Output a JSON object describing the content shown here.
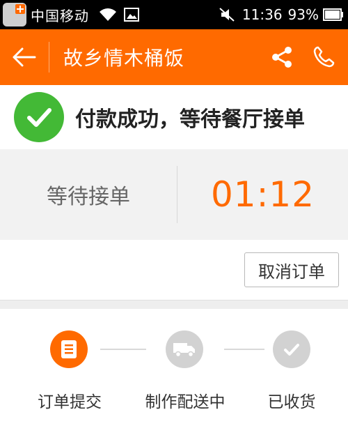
{
  "status_bar": {
    "carrier": "中国移动",
    "time": "11:36",
    "battery": "93%"
  },
  "header": {
    "title": "故乡情木桶饭",
    "accent_color": "#ff6a00"
  },
  "order_status": {
    "message": "付款成功，等待餐厅接单",
    "success_color": "#43b936"
  },
  "waiting": {
    "label": "等待接单",
    "countdown": "01:12"
  },
  "actions": {
    "cancel_label": "取消订单"
  },
  "progress": {
    "steps": [
      {
        "label": "订单提交",
        "icon": "document-icon",
        "state": "done"
      },
      {
        "label": "制作配送中",
        "icon": "truck-icon",
        "state": "pending"
      },
      {
        "label": "已收货",
        "icon": "check-icon",
        "state": "pending"
      }
    ]
  }
}
